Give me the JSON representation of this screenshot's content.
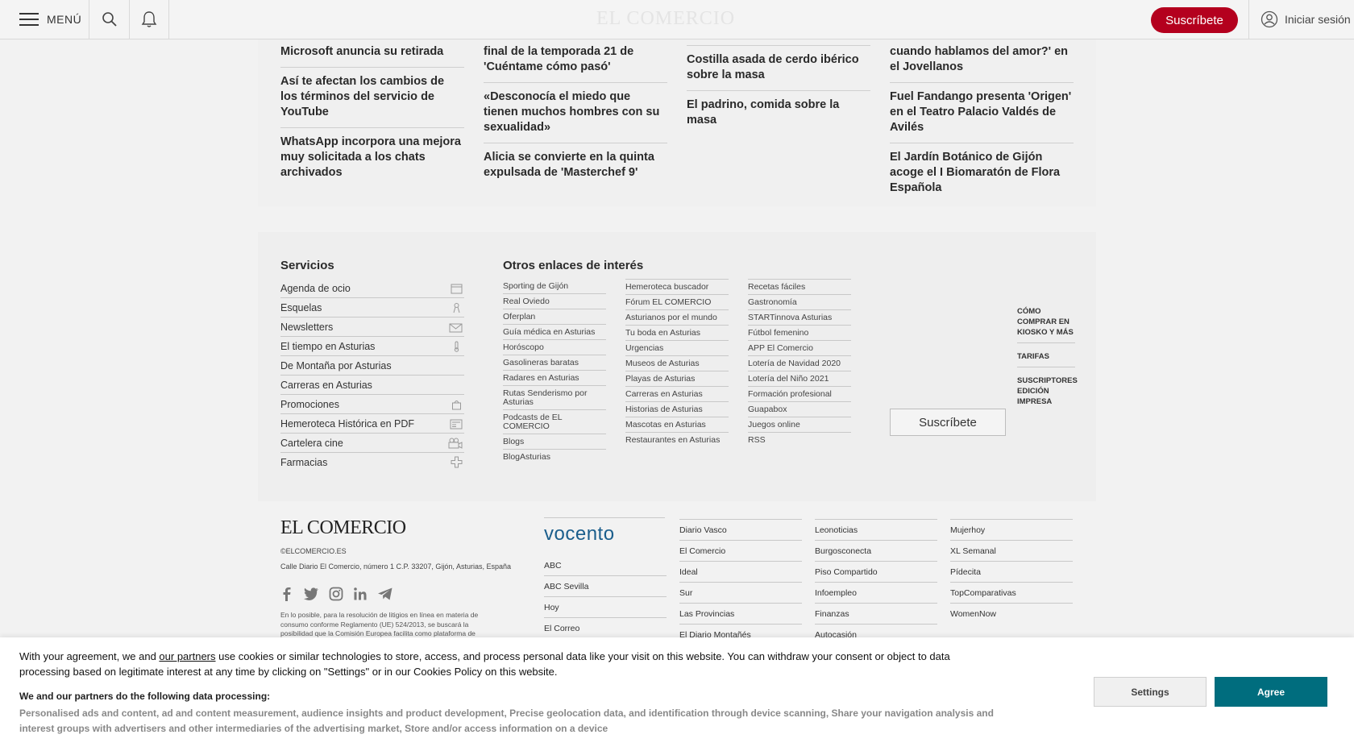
{
  "topbar": {
    "menu_label": "MENÚ",
    "logo_text": "EL COMERCIO",
    "subscribe_label": "Suscríbete",
    "login_label": "Iniciar sesión"
  },
  "articles": {
    "col1": [
      "Microsoft anuncia su retirada",
      "Así te afectan los cambios de los términos del servicio de YouTube",
      "WhatsApp incorpora una mejora muy solicitada a los chats archivados"
    ],
    "col2": [
      "final de la temporada 21 de 'Cuéntame cómo pasó'",
      "«Desconocía el miedo que tienen muchos hombres con su sexualidad»",
      "Alicia se convierte en la quinta expulsada de 'Masterchef 9'"
    ],
    "col3": [
      "Costilla asada de cerdo ibérico sobre la masa",
      "El padrino, comida sobre la masa"
    ],
    "col4": [
      "cuando hablamos del amor?' en el Jovellanos",
      "Fuel Fandango presenta 'Origen' en el Teatro Palacio Valdés de Avilés",
      "El Jardín Botánico de Gijón acoge el I Biomaratón de Flora Española"
    ]
  },
  "services": {
    "title": "Servicios",
    "items": [
      {
        "label": "Agenda de ocio",
        "icon": "calendar-icon"
      },
      {
        "label": "Esquelas",
        "icon": "ribbon-icon"
      },
      {
        "label": "Newsletters",
        "icon": "mail-icon"
      },
      {
        "label": "El tiempo en Asturias",
        "icon": "thermometer-icon"
      },
      {
        "label": "De Montaña por Asturias",
        "icon": ""
      },
      {
        "label": "Carreras en Asturias",
        "icon": ""
      },
      {
        "label": "Promociones",
        "icon": "bag-icon"
      },
      {
        "label": "Hemeroteca Histórica en PDF",
        "icon": "newspaper-icon"
      },
      {
        "label": "Cartelera cine",
        "icon": "camera-icon"
      },
      {
        "label": "Farmacias",
        "icon": "cross-icon"
      }
    ]
  },
  "other_links": {
    "title": "Otros enlaces de interés",
    "col1": [
      "Sporting de Gijón",
      "Real Oviedo",
      "Oferplan",
      "Guía médica en Asturias",
      "Horóscopo",
      "Gasolineras baratas",
      "Radares en Asturias",
      "Rutas Senderismo por Asturias",
      "Podcasts de EL COMERCIO",
      "Blogs",
      "BlogAsturias"
    ],
    "col2": [
      "Hemeroteca buscador",
      "Fórum EL COMERCIO",
      "Asturianos por el mundo",
      "Tu boda en Asturias",
      "Urgencias",
      "Museos de Asturias",
      "Playas de Asturias",
      "Carreras en Asturias",
      "Historias de Asturias",
      "Mascotas en Asturias",
      "Restaurantes en Asturias"
    ],
    "col3": [
      "Recetas fáciles",
      "Gastronomía",
      "STARTinnova Asturias",
      "Fútbol femenino",
      "APP El Comercio",
      "Lotería de Navidad 2020",
      "Lotería del Niño 2021",
      "Formación profesional",
      "Guapabox",
      "Juegos online",
      "RSS"
    ]
  },
  "subscribe_box": {
    "button_label": "Suscríbete",
    "links": [
      "CÓMO COMPRAR EN KIOSKO Y MÁS",
      "TARIFAS",
      "SUSCRIPTORES EDICIÓN IMPRESA"
    ]
  },
  "footer": {
    "logo": "EL COMERCIO",
    "site": "©ELCOMERCIO.ES",
    "address": "Calle Diario El Comercio, número 1 C.P. 33207, Gijón, Asturias, España",
    "legal": "En lo posible, para la resolución de litigios en línea en materia de consumo conforme Reglamento (UE) 524/2013, se buscará la posibilidad que la Comisión Europea facilita como plataforma de",
    "vocento": "vocento",
    "col1": [
      "ABC",
      "ABC Sevilla",
      "Hoy",
      "El Correo"
    ],
    "col2": [
      "Diario Vasco",
      "El Comercio",
      "Ideal",
      "Sur",
      "Las Provincias",
      "El Diario Montañés"
    ],
    "col3": [
      "Leonoticias",
      "Burgosconecta",
      "Piso Compartido",
      "Infoempleo",
      "Finanzas",
      "Autocasión"
    ],
    "col4": [
      "Mujerhoy",
      "XL Semanal",
      "Pídecita",
      "TopComparativas",
      "WomenNow"
    ],
    "social_icons": [
      "facebook-icon",
      "twitter-icon",
      "instagram-icon",
      "linkedin-icon",
      "telegram-icon"
    ]
  },
  "cookie": {
    "text_before_link": "With your agreement, we and ",
    "link_text": "our partners",
    "text_after_link": " use cookies or similar technologies to store, access, and process personal data like your visit on this website. You can withdraw your consent or object to data processing based on legitimate interest at any time by clicking on \"Settings\" or in our Cookies Policy on this website.",
    "purposes_title": "We and our partners do the following data processing:",
    "purposes": "Personalised ads and content, ad and content measurement, audience insights and product development, Precise geolocation data, and identification through device scanning, Share your navigation analysis and interest groups with advertisers and other intermediaries of the advertising market, Store and/or access information on a device",
    "settings_label": "Settings",
    "agree_label": "Agree"
  },
  "colors": {
    "subscribe_red": "#b4001e",
    "agree_teal": "#006d7e",
    "vocento_blue": "#1b5e8c"
  }
}
